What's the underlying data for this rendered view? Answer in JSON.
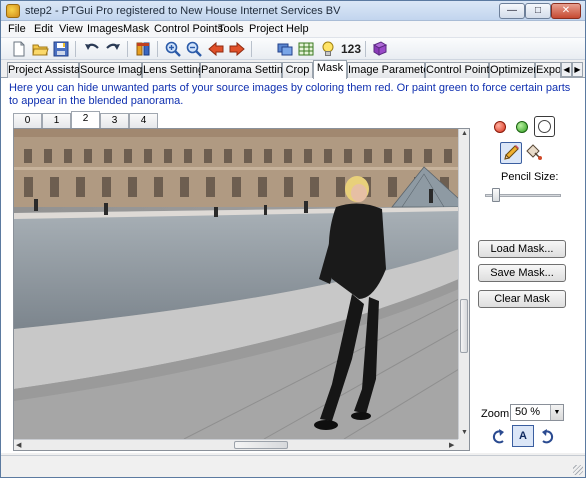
{
  "window": {
    "title": "step2 - PTGui Pro registered to New House Internet Services BV"
  },
  "menu": [
    "File",
    "Edit",
    "View",
    "Images",
    "Mask",
    "Control Points",
    "Tools",
    "Project",
    "Help"
  ],
  "toolbar": {
    "number_label": "123"
  },
  "tabs": [
    "Project Assistant",
    "Source Images",
    "Lens Settings",
    "Panorama Settings",
    "Crop",
    "Mask",
    "Image Parameters",
    "Control Points",
    "Optimizer",
    "Expo"
  ],
  "active_tab": "Mask",
  "info_text": "Here you can hide unwanted parts of your source images by coloring them red. Or paint green to force certain parts to appear in the blended panorama.",
  "image_tabs": [
    "0",
    "1",
    "2",
    "3",
    "4"
  ],
  "active_image_tab": "2",
  "panel": {
    "pencil_size_label": "Pencil Size:",
    "pencil_size": 0.1,
    "load_mask": "Load Mask...",
    "save_mask": "Save Mask...",
    "clear_mask": "Clear Mask",
    "zoom_label": "Zoom:",
    "zoom_value": "50 %",
    "auto_label": "A"
  }
}
